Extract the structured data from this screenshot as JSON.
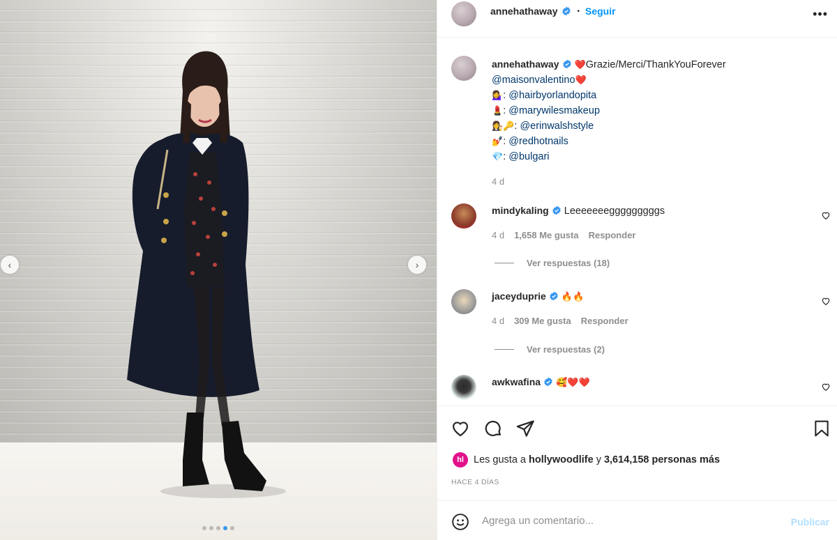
{
  "header": {
    "username": "annehathaway",
    "separator": "•",
    "follow_label": "Seguir",
    "more_label": "•••"
  },
  "media": {
    "prev_arrow": "‹",
    "next_arrow": "›",
    "carousel_total": 5,
    "carousel_active": 4
  },
  "caption": {
    "username": "annehathaway",
    "lines": [
      {
        "emoji": "❤️",
        "mention": "",
        "text": "Grazie/Merci/ThankYouForever"
      },
      {
        "emoji": "",
        "mention": "@maisonvalentino",
        "text": " ❤️"
      },
      {
        "emoji": "💁‍♀️",
        "mention": "@hairbyorlandopita",
        "text": ": "
      },
      {
        "emoji": "💄",
        "mention": "@marywilesmakeup",
        "text": ": "
      },
      {
        "emoji": "👩‍⚖️🔑",
        "mention": "@erinwalshstyle",
        "text": ": "
      },
      {
        "emoji": "💅",
        "mention": "@redhotnails",
        "text": ": "
      },
      {
        "emoji": "💎",
        "mention": "@bulgari",
        "text": ": "
      }
    ],
    "time": "4 d"
  },
  "comments": [
    {
      "username": "mindykaling",
      "text": "Leeeeeeegggggggggs",
      "time": "4 d",
      "likes": "1,658 Me gusta",
      "reply": "Responder",
      "view_replies": "Ver respuestas (18)"
    },
    {
      "username": "jaceyduprie",
      "text": "🔥🔥",
      "time": "4 d",
      "likes": "309 Me gusta",
      "reply": "Responder",
      "view_replies": "Ver respuestas (2)"
    },
    {
      "username": "awkwafina",
      "text": "🥰❤️❤️"
    }
  ],
  "likes": {
    "prefix": "Les gusta a ",
    "user": "hollywoodlife",
    "middle": " y ",
    "count": "3,614,158 personas más",
    "logo_text": "hl"
  },
  "timeago": "HACE 4 DÍAS",
  "add_comment": {
    "placeholder": "Agrega un comentario...",
    "publish_label": "Publicar"
  },
  "colors": {
    "accent": "#0095f6",
    "verified": "#3897f0",
    "mention": "#00376b",
    "muted": "#8e8e8e"
  }
}
